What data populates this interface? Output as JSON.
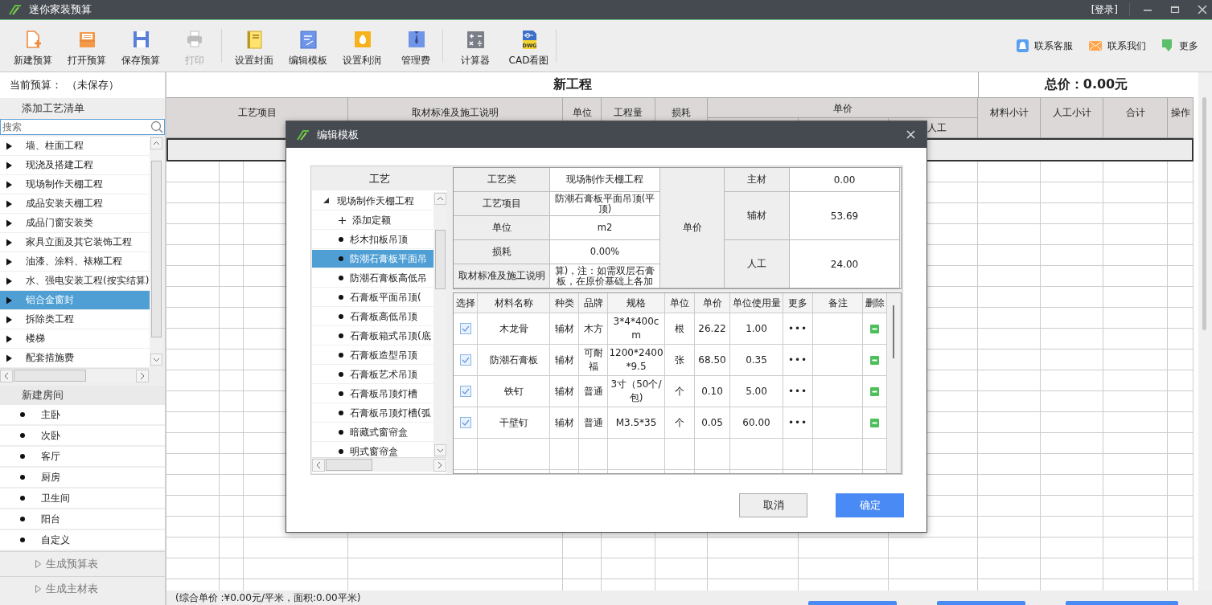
{
  "window": {
    "title": "迷你家装预算",
    "login": "[登录]"
  },
  "toolbar": {
    "groups": [
      [
        {
          "label": "新建预算",
          "disabled": false
        },
        {
          "label": "打开预算",
          "disabled": false
        },
        {
          "label": "保存预算",
          "disabled": false
        },
        {
          "label": "打印",
          "disabled": true
        }
      ],
      [
        {
          "label": "设置封面",
          "disabled": false
        },
        {
          "label": "编辑模板",
          "disabled": false
        },
        {
          "label": "设置利润",
          "disabled": false
        },
        {
          "label": "管理费",
          "disabled": false
        }
      ],
      [
        {
          "label": "计算器",
          "disabled": false
        },
        {
          "label": "CAD看图",
          "icon_text": "DWG",
          "disabled": false
        }
      ]
    ],
    "links": [
      {
        "label": "联系客服"
      },
      {
        "label": "联系我们"
      },
      {
        "label": "更多"
      }
    ]
  },
  "budget": {
    "label": "当前预算：",
    "value": "（未保存）"
  },
  "process_list": {
    "title": "添加工艺清单",
    "search": {
      "placeholder": "搜索"
    },
    "items": [
      {
        "label": "墙、柱面工程",
        "expanded": false,
        "selected": false
      },
      {
        "label": "现浇及搭建工程",
        "expanded": false,
        "selected": false
      },
      {
        "label": "现场制作天棚工程",
        "expanded": false,
        "selected": false
      },
      {
        "label": "成品安装天棚工程",
        "expanded": false,
        "selected": false
      },
      {
        "label": "成品门窗安装类",
        "expanded": false,
        "selected": false
      },
      {
        "label": "家具立面及其它装饰工程",
        "expanded": false,
        "selected": false
      },
      {
        "label": "油漆、涂料、裱糊工程",
        "expanded": false,
        "selected": false
      },
      {
        "label": "水、强电安装工程(按实结算)",
        "expanded": false,
        "selected": false
      },
      {
        "label": "铝合金窗封",
        "expanded": false,
        "selected": true
      },
      {
        "label": "拆除类工程",
        "expanded": false,
        "selected": false
      },
      {
        "label": "楼梯",
        "expanded": false,
        "selected": false
      },
      {
        "label": "配套措施费",
        "expanded": false,
        "selected": false
      }
    ]
  },
  "rooms": {
    "title": "新建房间",
    "items": [
      "主卧",
      "次卧",
      "客厅",
      "厨房",
      "卫生间",
      "阳台",
      "自定义"
    ]
  },
  "actions": [
    {
      "label": "生成预算表"
    },
    {
      "label": "生成主材表"
    }
  ],
  "sheet": {
    "title": "新工程",
    "total": "总价：0.00元",
    "columns": [
      "工艺项目",
      "取材标准及施工说明",
      "单位",
      "工程量",
      "损耗",
      "材料小计",
      "人工小计",
      "合计",
      "操作"
    ],
    "price_group": {
      "label": "单价",
      "visible_sub": "人工"
    },
    "status": "(综合单价 :¥0.00元/平米，面积:0.00平米)"
  },
  "dialog": {
    "title": "编辑模板",
    "tree": {
      "title": "工艺",
      "groups": [
        {
          "label": "现场制作天棚工程",
          "expanded": true,
          "children": [
            {
              "kind": "add",
              "label": "添加定额",
              "selected": false
            },
            {
              "kind": "item",
              "label": "杉木扣板吊顶",
              "selected": false
            },
            {
              "kind": "item",
              "label": "防潮石膏板平面吊",
              "selected": true
            },
            {
              "kind": "item",
              "label": "防潮石膏板高低吊",
              "selected": false
            },
            {
              "kind": "item",
              "label": "石膏板平面吊顶(",
              "selected": false
            },
            {
              "kind": "item",
              "label": "石膏板高低吊顶",
              "selected": false
            },
            {
              "kind": "item",
              "label": "石膏板箱式吊顶(底",
              "selected": false
            },
            {
              "kind": "item",
              "label": "石膏板造型吊顶",
              "selected": false
            },
            {
              "kind": "item",
              "label": "石膏板艺术吊顶",
              "selected": false
            },
            {
              "kind": "item",
              "label": "石膏板吊顶灯槽",
              "selected": false
            },
            {
              "kind": "item",
              "label": "石膏板吊顶灯槽(弧",
              "selected": false
            },
            {
              "kind": "item",
              "label": "暗藏式窗帘盒",
              "selected": false
            },
            {
              "kind": "item",
              "label": "明式窗帘盒",
              "selected": false
            }
          ]
        }
      ]
    },
    "info": {
      "rows": [
        {
          "label": "工艺类",
          "value": "现场制作天棚工程"
        },
        {
          "label": "工艺项目",
          "value": "防潮石膏板平面吊顶(平顶)"
        },
        {
          "label": "单位",
          "value": "m2"
        },
        {
          "label": "损耗",
          "value": "0.00%"
        },
        {
          "label": "取材标准及施工说明",
          "value": "算)，注：如需双层石膏板，在原价基础上各加"
        }
      ],
      "price_label": "单价",
      "prices": [
        {
          "label": "主材",
          "value": "0.00"
        },
        {
          "label": "辅材",
          "value": "53.69"
        },
        {
          "label": "人工",
          "value": "24.00"
        }
      ]
    },
    "materials": {
      "columns": [
        "选择",
        "材料名称",
        "种类",
        "品牌",
        "规格",
        "单位",
        "单价",
        "单位使用量",
        "更多",
        "备注",
        "删除"
      ],
      "rows": [
        {
          "checked": true,
          "material": "木龙骨",
          "type": "辅材",
          "brand": "木方",
          "spec": "3*4*400cm",
          "unit": "根",
          "price": "26.22",
          "usage": "1.00",
          "more": "•••"
        },
        {
          "checked": true,
          "material": "防潮石膏板",
          "type": "辅材",
          "brand": "可耐福",
          "spec": "1200*2400*9.5",
          "unit": "张",
          "price": "68.50",
          "usage": "0.35",
          "more": "•••"
        },
        {
          "checked": true,
          "material": "铁钉",
          "type": "辅材",
          "brand": "普通",
          "spec": "3寸（50个/包)",
          "unit": "个",
          "price": "0.10",
          "usage": "5.00",
          "more": "•••"
        },
        {
          "checked": true,
          "material": "干壁钉",
          "type": "辅材",
          "brand": "普通",
          "spec": "M3.5*35",
          "unit": "个",
          "price": "0.05",
          "usage": "60.00",
          "more": "•••"
        }
      ]
    },
    "buttons": [
      {
        "label": "取消",
        "kind": "secondary"
      },
      {
        "label": "确定",
        "kind": "primary"
      }
    ]
  }
}
